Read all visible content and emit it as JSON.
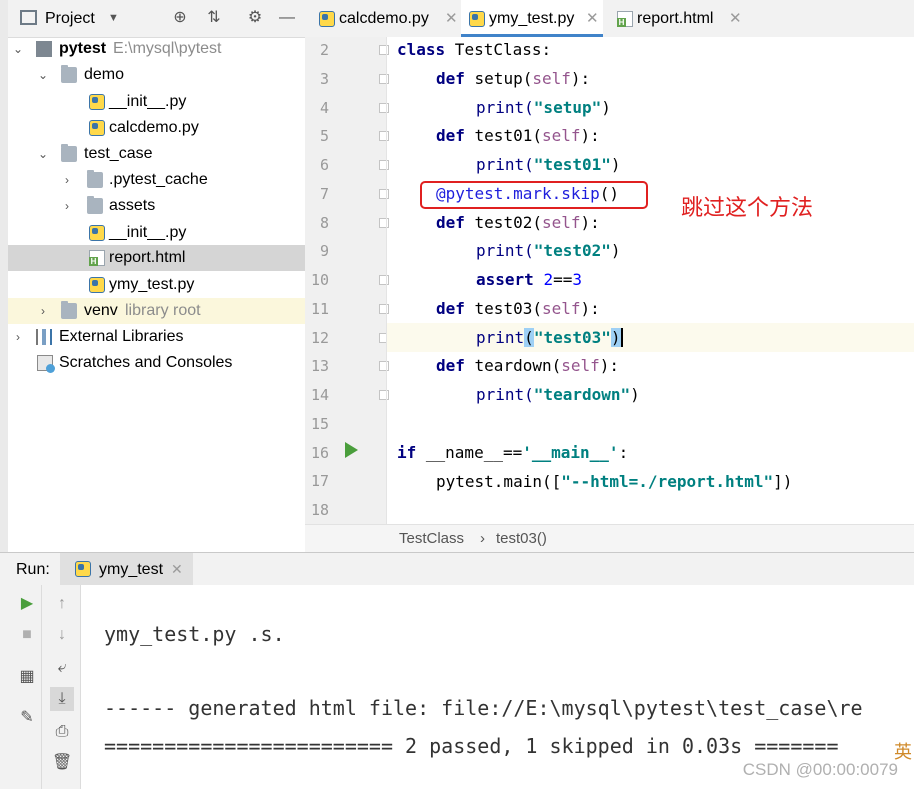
{
  "project_panel": {
    "title": "Project",
    "tree": [
      {
        "label": "pytest",
        "extra": "E:\\mysql\\pytest"
      },
      {
        "label": "demo"
      },
      {
        "label": "__init__.py"
      },
      {
        "label": "calcdemo.py"
      },
      {
        "label": "test_case"
      },
      {
        "label": ".pytest_cache"
      },
      {
        "label": "assets"
      },
      {
        "label": "__init__.py"
      },
      {
        "label": "report.html"
      },
      {
        "label": "ymy_test.py"
      },
      {
        "label": "venv",
        "extra": "library root"
      },
      {
        "label": "External Libraries"
      },
      {
        "label": "Scratches and Consoles"
      }
    ]
  },
  "tabs": [
    {
      "label": "calcdemo.py"
    },
    {
      "label": "ymy_test.py"
    },
    {
      "label": "report.html"
    }
  ],
  "editor": {
    "line_numbers": [
      "2",
      "3",
      "4",
      "5",
      "6",
      "7",
      "8",
      "9",
      "10",
      "11",
      "12",
      "13",
      "14",
      "15",
      "16",
      "17",
      "18"
    ],
    "lines": {
      "l2": {
        "kw": "class",
        "rest": " TestClass:"
      },
      "l3": {
        "kw": "def",
        "name": " setup(",
        "self": "self",
        "end": "):"
      },
      "l4": {
        "fn": "print(",
        "str": "\"setup\"",
        "end": ")"
      },
      "l5": {
        "kw": "def",
        "name": " test01(",
        "self": "self",
        "end": "):"
      },
      "l6": {
        "fn": "print(",
        "str": "\"test01\"",
        "end": ")"
      },
      "l7": {
        "deco": "@pytest.mark.skip",
        "end": "()"
      },
      "l8": {
        "kw": "def",
        "name": " test02(",
        "self": "self",
        "end": "):"
      },
      "l9": {
        "fn": "print(",
        "str": "\"test02\"",
        "end": ")"
      },
      "l10": {
        "kw": "assert",
        "sp": " ",
        "n1": "2",
        "op": "==",
        "n2": "3"
      },
      "l11": {
        "kw": "def",
        "name": " test03(",
        "self": "self",
        "end": "):"
      },
      "l12": {
        "fn": "print",
        "lp": "(",
        "str": "\"test03\"",
        "rp": ")"
      },
      "l13": {
        "kw": "def",
        "name": " teardown(",
        "self": "self",
        "end": "):"
      },
      "l14": {
        "fn": "print(",
        "str": "\"teardown\"",
        "end": ")"
      },
      "l16": {
        "kw": "if",
        "sp": " __name__==",
        "str": "'__main__'",
        "end": ":"
      },
      "l17": {
        "fn": "pytest.main([",
        "str": "\"--html=./report.html\"",
        "end": "])"
      }
    },
    "annotation": "跳过这个方法"
  },
  "breadcrumb": {
    "class": "TestClass",
    "sep": "›",
    "method": "test03()"
  },
  "run": {
    "label": "Run:",
    "tab": "ymy_test",
    "console": [
      "ymy_test.py .s.",
      "------ generated html file: file://E:\\mysql\\pytest\\test_case\\re",
      "======================== 2 passed, 1 skipped in 0.03s ======="
    ]
  },
  "watermark": "CSDN @00:00:0079",
  "ime": "英",
  "colors": {
    "accent": "#4083c9",
    "annotation_red": "#e02020",
    "run_green": "#4a9e3c"
  }
}
